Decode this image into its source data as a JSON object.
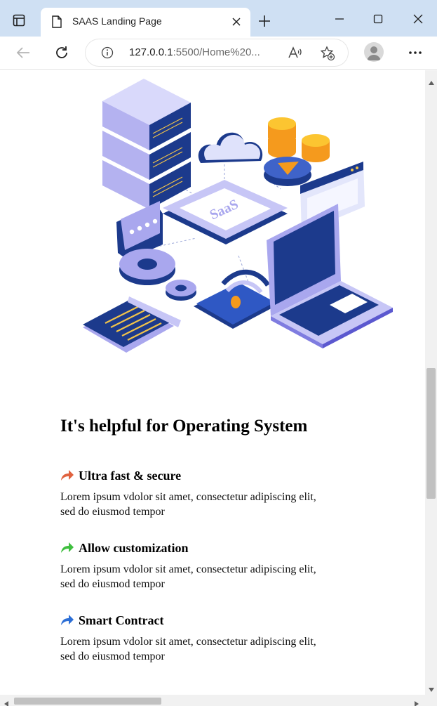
{
  "browser": {
    "tab_title": "SAAS Landing Page",
    "url_host": "127.0.0.1",
    "url_rest": ":5500/Home%20...",
    "icons": [
      "sidebar-toggle-icon",
      "document-icon",
      "close-icon",
      "new-tab-icon",
      "minimize-icon",
      "maximize-icon",
      "close-window-icon",
      "back-icon",
      "refresh-icon",
      "info-icon",
      "read-aloud-icon",
      "add-favorite-icon",
      "profile-icon",
      "more-icon"
    ]
  },
  "hero": {
    "illustration_label": "SaaS"
  },
  "features": {
    "title": "It's helpful for Operating System",
    "items": [
      {
        "icon": "share-arrow-icon",
        "color": "#e0623f",
        "heading": "Ultra fast & secure",
        "text": "Lorem ipsum vdolor sit amet, consectetur adipiscing elit, sed do eiusmod tempor"
      },
      {
        "icon": "share-arrow-icon",
        "color": "#3fbf3f",
        "heading": "Allow customization",
        "text": "Lorem ipsum vdolor sit amet, consectetur adipiscing elit, sed do eiusmod tempor"
      },
      {
        "icon": "share-arrow-icon",
        "color": "#2d6fd6",
        "heading": "Smart Contract",
        "text": "Lorem ipsum vdolor sit amet, consectetur adipiscing elit, sed do eiusmod tempor"
      }
    ]
  }
}
